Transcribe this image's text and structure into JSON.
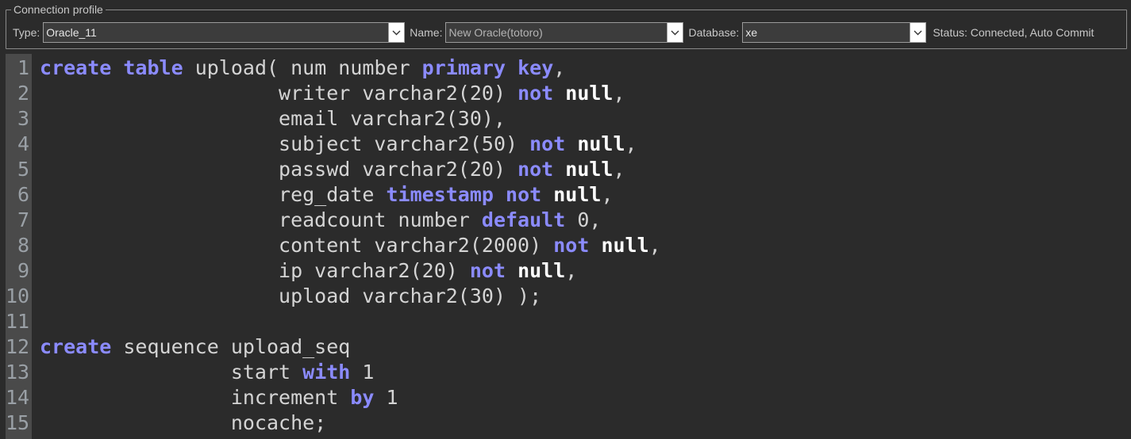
{
  "profile": {
    "legend": "Connection profile",
    "type_label": "Type:",
    "type_value": "Oracle_11",
    "name_label": "Name:",
    "name_value": "New Oracle(totoro)",
    "database_label": "Database:",
    "database_value": "xe",
    "status": "Status: Connected, Auto Commit"
  },
  "editor": {
    "lines": [
      {
        "n": "1",
        "tokens": [
          [
            "kw",
            "create"
          ],
          [
            "t",
            " "
          ],
          [
            "kw",
            "table"
          ],
          [
            "t",
            " upload( num number "
          ],
          [
            "kw",
            "primary"
          ],
          [
            "t",
            " "
          ],
          [
            "kw",
            "key"
          ],
          [
            "t",
            ","
          ]
        ]
      },
      {
        "n": "2",
        "tokens": [
          [
            "t",
            "                    writer varchar2(20) "
          ],
          [
            "kw",
            "not"
          ],
          [
            "t",
            " "
          ],
          [
            "wh",
            "null"
          ],
          [
            "t",
            ","
          ]
        ]
      },
      {
        "n": "3",
        "tokens": [
          [
            "t",
            "                    email varchar2(30),"
          ]
        ]
      },
      {
        "n": "4",
        "tokens": [
          [
            "t",
            "                    subject varchar2(50) "
          ],
          [
            "kw",
            "not"
          ],
          [
            "t",
            " "
          ],
          [
            "wh",
            "null"
          ],
          [
            "t",
            ","
          ]
        ]
      },
      {
        "n": "5",
        "tokens": [
          [
            "t",
            "                    passwd varchar2(20) "
          ],
          [
            "kw",
            "not"
          ],
          [
            "t",
            " "
          ],
          [
            "wh",
            "null"
          ],
          [
            "t",
            ","
          ]
        ]
      },
      {
        "n": "6",
        "tokens": [
          [
            "t",
            "                    reg_date "
          ],
          [
            "kw",
            "timestamp"
          ],
          [
            "t",
            " "
          ],
          [
            "kw",
            "not"
          ],
          [
            "t",
            " "
          ],
          [
            "wh",
            "null"
          ],
          [
            "t",
            ","
          ]
        ]
      },
      {
        "n": "7",
        "tokens": [
          [
            "t",
            "                    readcount number "
          ],
          [
            "kw",
            "default"
          ],
          [
            "t",
            " 0,"
          ]
        ]
      },
      {
        "n": "8",
        "tokens": [
          [
            "t",
            "                    content varchar2(2000) "
          ],
          [
            "kw",
            "not"
          ],
          [
            "t",
            " "
          ],
          [
            "wh",
            "null"
          ],
          [
            "t",
            ","
          ]
        ]
      },
      {
        "n": "9",
        "tokens": [
          [
            "t",
            "                    ip varchar2(20) "
          ],
          [
            "kw",
            "not"
          ],
          [
            "t",
            " "
          ],
          [
            "wh",
            "null"
          ],
          [
            "t",
            ","
          ]
        ]
      },
      {
        "n": "10",
        "tokens": [
          [
            "t",
            "                    upload varchar2(30) );"
          ]
        ]
      },
      {
        "n": "11",
        "tokens": []
      },
      {
        "n": "12",
        "tokens": [
          [
            "kw",
            "create"
          ],
          [
            "t",
            " sequence upload_seq"
          ]
        ]
      },
      {
        "n": "13",
        "tokens": [
          [
            "t",
            "                start "
          ],
          [
            "kw",
            "with"
          ],
          [
            "t",
            " 1"
          ]
        ]
      },
      {
        "n": "14",
        "tokens": [
          [
            "t",
            "                increment "
          ],
          [
            "kw",
            "by"
          ],
          [
            "t",
            " 1"
          ]
        ]
      },
      {
        "n": "15",
        "tokens": [
          [
            "t",
            "                nocache;"
          ]
        ]
      }
    ]
  }
}
